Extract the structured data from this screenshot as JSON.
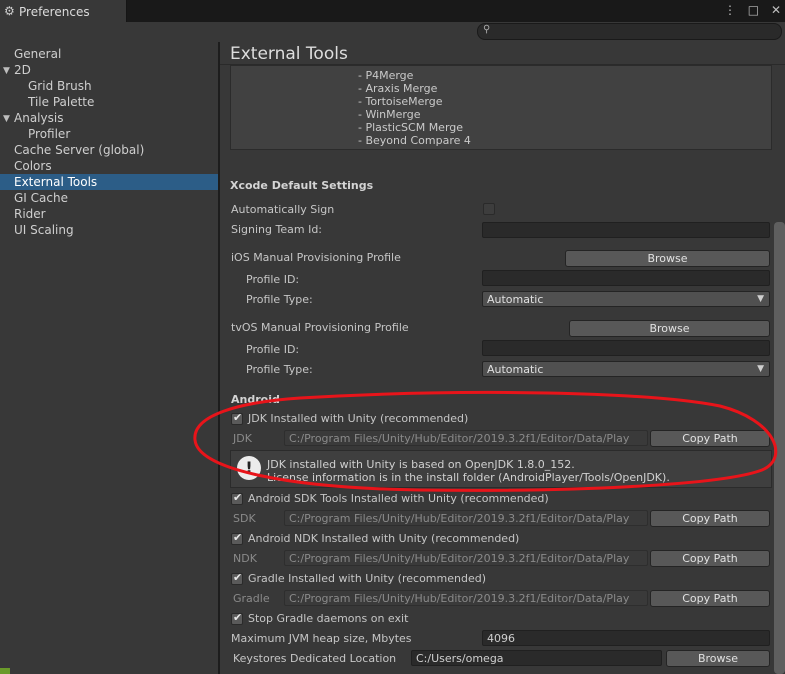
{
  "window": {
    "title": "Preferences",
    "menu_icon": "⋮",
    "maximize_icon": "□",
    "close_icon": "✕"
  },
  "sidebar": {
    "items": [
      {
        "label": "General"
      },
      {
        "label": "2D"
      },
      {
        "label": "Grid Brush"
      },
      {
        "label": "Tile Palette"
      },
      {
        "label": "Analysis"
      },
      {
        "label": "Profiler"
      },
      {
        "label": "Cache Server (global)"
      },
      {
        "label": "Colors"
      },
      {
        "label": "External Tools"
      },
      {
        "label": "GI Cache"
      },
      {
        "label": "Rider"
      },
      {
        "label": "UI Scaling"
      }
    ]
  },
  "main": {
    "title": "External Tools",
    "merge_tools": [
      "- P4Merge",
      "- Araxis Merge",
      "- TortoiseMerge",
      "- WinMerge",
      "- PlasticSCM Merge",
      "- Beyond Compare 4"
    ],
    "xcode": {
      "heading": "Xcode Default Settings",
      "auto_sign": "Automatically Sign",
      "team_id": "Signing Team Id:",
      "ios_profile": "iOS Manual Provisioning Profile",
      "tvos_profile": "tvOS Manual Provisioning Profile",
      "browse": "Browse",
      "profile_id": "Profile ID:",
      "profile_type": "Profile Type:",
      "automatic": "Automatic"
    },
    "android": {
      "heading": "Android",
      "jdk_check": "JDK Installed with Unity (recommended)",
      "jdk_label": "JDK",
      "path": "C:/Program Files/Unity/Hub/Editor/2019.3.2f1/Editor/Data/Play",
      "copy_path": "Copy Path",
      "info_line1": "JDK installed with Unity is based on OpenJDK 1.8.0_152.",
      "info_line2": "License information is in the install folder (AndroidPlayer/Tools/OpenJDK).",
      "sdk_check": "Android SDK Tools Installed with Unity (recommended)",
      "sdk_label": "SDK",
      "ndk_check": "Android NDK Installed with Unity (recommended)",
      "ndk_label": "NDK",
      "gradle_check": "Gradle Installed with Unity (recommended)",
      "gradle_label": "Gradle",
      "stop_gradle": "Stop Gradle daemons on exit",
      "jvm_heap": "Maximum JVM heap size, Mbytes",
      "jvm_value": "4096",
      "keystores": "Keystores Dedicated Location",
      "keystores_value": "C:/Users/omega",
      "browse": "Browse"
    }
  }
}
